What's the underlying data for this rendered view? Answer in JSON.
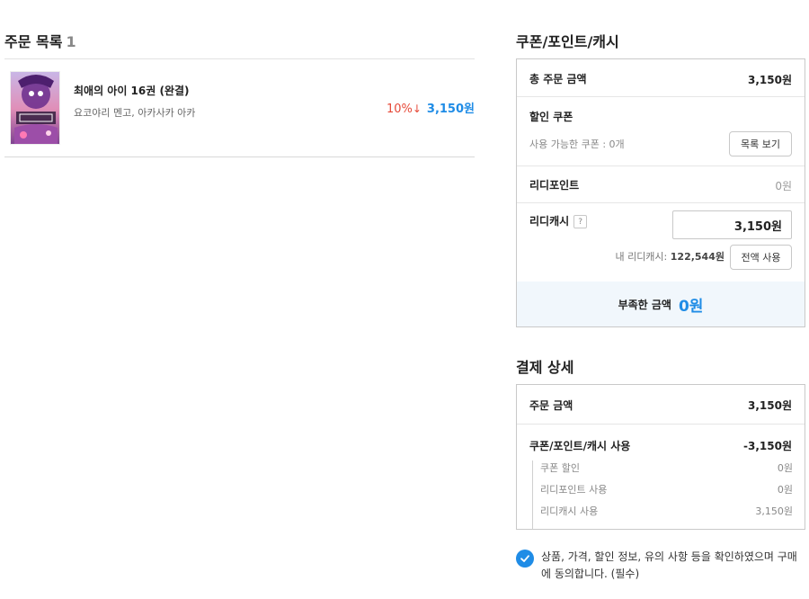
{
  "order": {
    "title": "주문 목록",
    "count": "1",
    "items": [
      {
        "title": "최애의 아이 16권 (완결)",
        "author": "요코야리 멘고, 아카사카 아카",
        "discount": "10%",
        "discount_icon": "down-arrow-icon",
        "price": "3,150원"
      }
    ]
  },
  "coupon": {
    "title": "쿠폰/포인트/캐시",
    "total_label": "총 주문 금액",
    "total_value": "3,150원",
    "discount_coupon_label": "할인 쿠폰",
    "available_coupons": "사용 가능한 쿠폰 : 0개",
    "list_button": "목록 보기",
    "ridipoint_label": "리디포인트",
    "ridipoint_value": "0원",
    "ridicash_label": "리디캐시",
    "help_label": "?",
    "ridicash_input": "3,150원",
    "my_cash_label": "내 리디캐시:",
    "my_cash_value": "122,544원",
    "use_all_button": "전액 사용",
    "shortage_label": "부족한 금액",
    "shortage_value": "0원"
  },
  "payment": {
    "title": "결제 상세",
    "order_amount_label": "주문 금액",
    "order_amount_value": "3,150원",
    "usage_label": "쿠폰/포인트/캐시 사용",
    "usage_value": "-3,150원",
    "breakdown": [
      {
        "label": "쿠폰 할인",
        "value": "0원"
      },
      {
        "label": "리디포인트 사용",
        "value": "0원"
      },
      {
        "label": "리디캐시 사용",
        "value": "3,150원"
      }
    ]
  },
  "agreement": {
    "text": "상품, 가격, 할인 정보, 유의 사항 등을 확인하였으며 구매에 동의합니다. (필수)",
    "checked": true
  },
  "colors": {
    "accent": "#1f8ce6",
    "discount": "#e64938"
  }
}
